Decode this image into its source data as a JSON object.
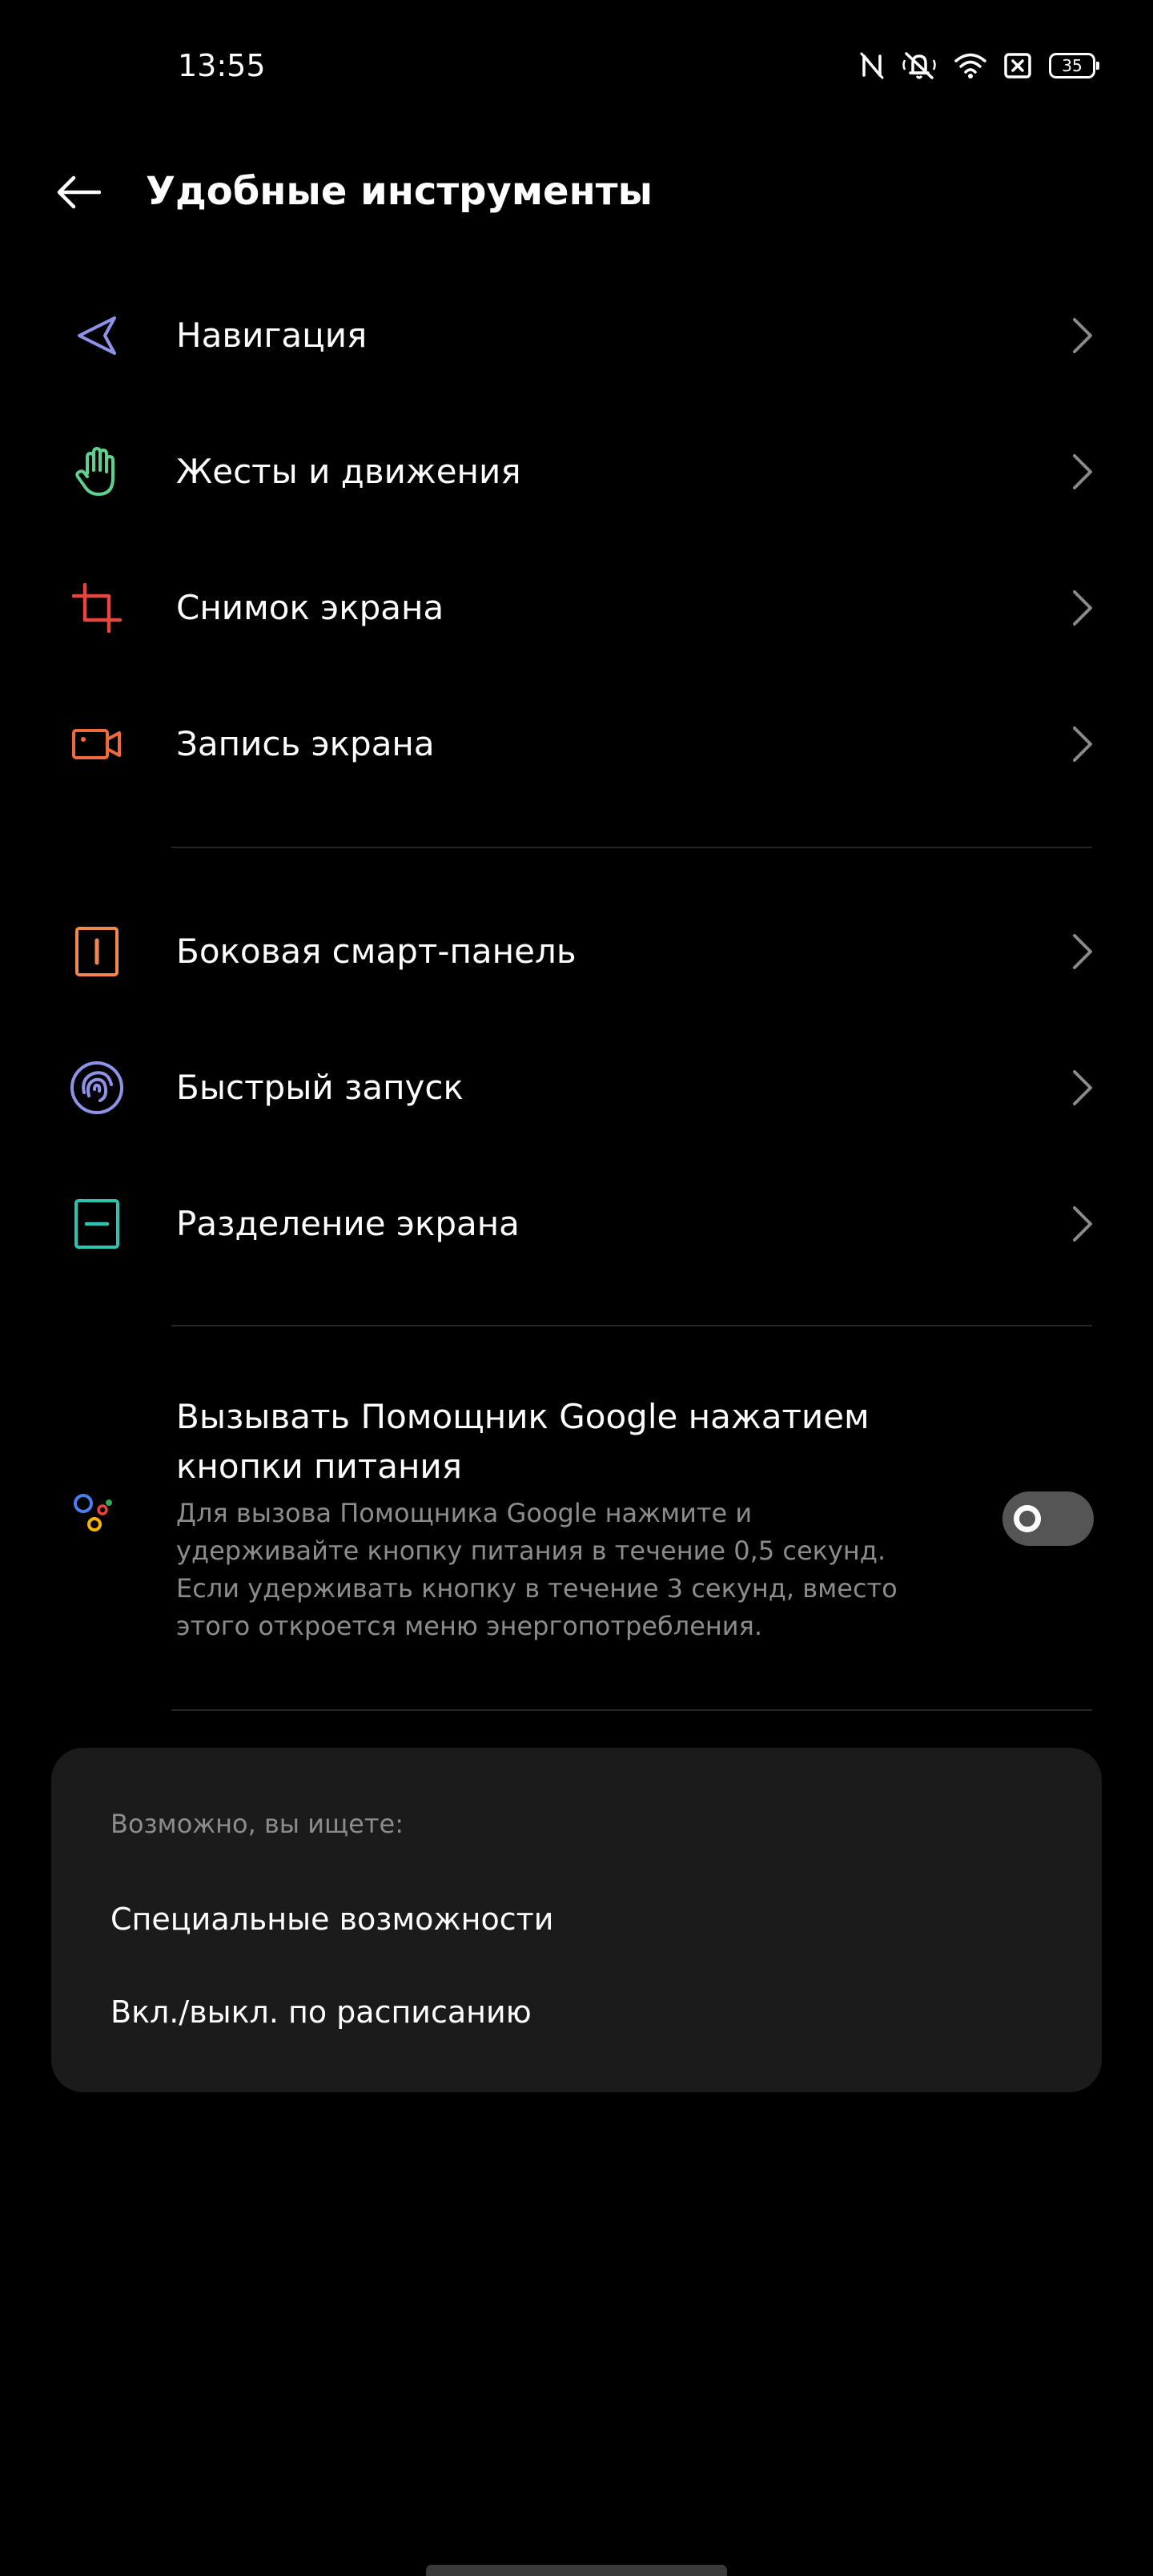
{
  "status_bar": {
    "time": "13:55",
    "battery": "35",
    "icons": [
      "nfc-icon",
      "mute-icon",
      "wifi-icon",
      "sim-no-signal-icon",
      "battery-icon"
    ]
  },
  "header": {
    "title": "Удобные инструменты",
    "back_icon": "arrow-left-icon"
  },
  "menu": {
    "items": [
      {
        "label": "Навигация",
        "icon": "navigation-arrow-icon",
        "color": "#8f93e8"
      },
      {
        "label": "Жесты и движения",
        "icon": "hand-icon",
        "color": "#5fd18f"
      },
      {
        "label": "Снимок экрана",
        "icon": "crop-icon",
        "color": "#e8453c"
      },
      {
        "label": "Запись экрана",
        "icon": "video-camera-icon",
        "color": "#f06a3c"
      },
      {
        "label": "Боковая смарт-панель",
        "icon": "side-panel-icon",
        "color": "#f2884d"
      },
      {
        "label": "Быстрый запуск",
        "icon": "fingerprint-circle-icon",
        "color": "#8f93e8"
      },
      {
        "label": "Разделение экрана",
        "icon": "split-screen-icon",
        "color": "#2ec4b0"
      }
    ]
  },
  "assistant": {
    "title": "Вызывать Помощник Google нажатием кнопки питания",
    "description": "Для вызова Помощника Google нажмите и удерживайте кнопку питания в течение 0,5 секунд. Если удерживать кнопку в течение 3 секунд, вместо этого откроется меню энергопотребления.",
    "toggle_on": false,
    "icon": "google-assistant-icon"
  },
  "suggestions": {
    "heading": "Возможно, вы ищете:",
    "links": [
      "Специальные возможности",
      "Вкл./выкл. по расписанию"
    ]
  },
  "colors": {
    "background": "#000000",
    "card": "#1b1b1b",
    "secondary_text": "#8c8c8c",
    "chevron": "#8a8a8a"
  }
}
